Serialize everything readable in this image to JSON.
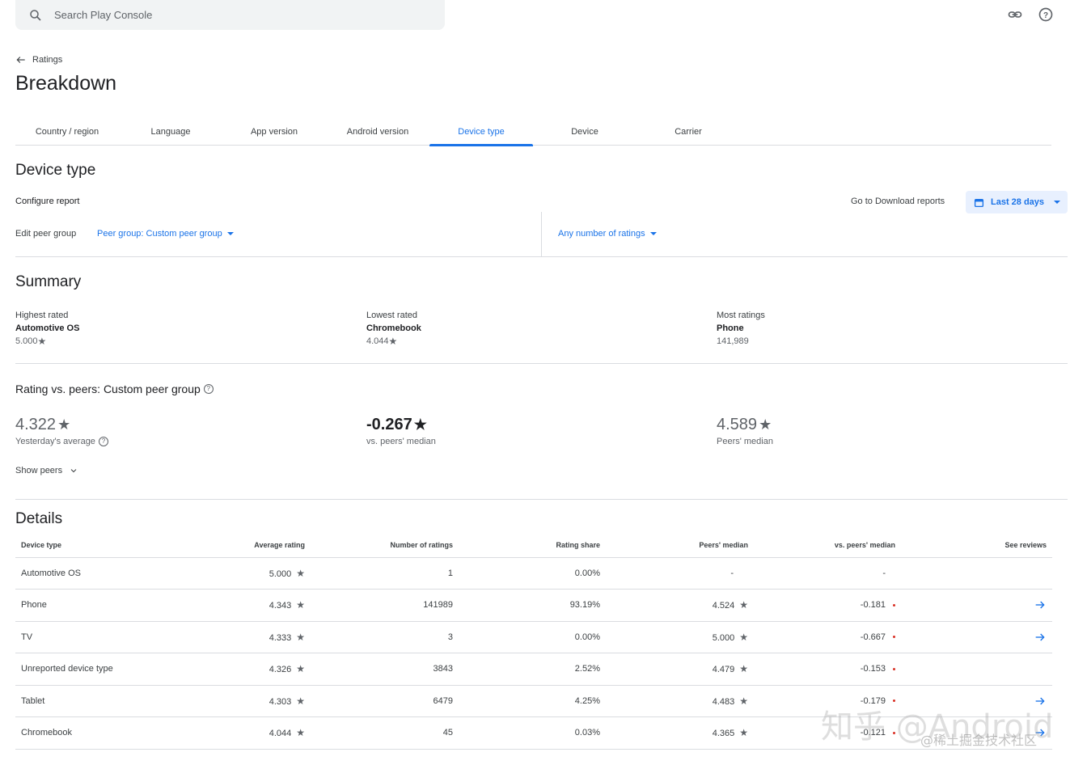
{
  "search": {
    "placeholder": "Search Play Console"
  },
  "header": {
    "back_label": "Ratings",
    "title": "Breakdown"
  },
  "tabs": [
    {
      "label": "Country / region"
    },
    {
      "label": "Language"
    },
    {
      "label": "App version"
    },
    {
      "label": "Android version"
    },
    {
      "label": "Device type"
    },
    {
      "label": "Device"
    },
    {
      "label": "Carrier"
    }
  ],
  "active_tab": "Device type",
  "section": {
    "title": "Device type",
    "configure_label": "Configure report",
    "download_link": "Go to Download reports",
    "date_range": "Last 28 days",
    "edit_peer_label": "Edit peer group",
    "peer_group_select": "Peer group: Custom peer group",
    "ratings_filter": "Any number of ratings"
  },
  "summary": {
    "title": "Summary",
    "highest": {
      "label": "Highest rated",
      "name": "Automotive OS",
      "value": "5.000"
    },
    "lowest": {
      "label": "Lowest rated",
      "name": "Chromebook",
      "value": "4.044"
    },
    "most": {
      "label": "Most ratings",
      "name": "Phone",
      "value": "141,989"
    }
  },
  "peers": {
    "title": "Rating vs. peers: Custom peer group",
    "average": {
      "value": "4.322",
      "label": "Yesterday's average"
    },
    "diff": {
      "value": "-0.267",
      "label": "vs. peers' median"
    },
    "median": {
      "value": "4.589",
      "label": "Peers' median"
    },
    "show_peers": "Show peers"
  },
  "details": {
    "title": "Details",
    "columns": [
      "Device type",
      "Average rating",
      "Number of ratings",
      "Rating share",
      "Peers' median",
      "vs. peers' median",
      "See reviews"
    ],
    "rows": [
      {
        "type": "Automotive OS",
        "avg": "5.000",
        "count": "1",
        "share": "0.00%",
        "peer": "-",
        "diff": "-",
        "has_peer_star": false,
        "has_dot": false,
        "reviews": false
      },
      {
        "type": "Phone",
        "avg": "4.343",
        "count": "141989",
        "share": "93.19%",
        "peer": "4.524",
        "diff": "-0.181",
        "has_peer_star": true,
        "has_dot": true,
        "reviews": true
      },
      {
        "type": "TV",
        "avg": "4.333",
        "count": "3",
        "share": "0.00%",
        "peer": "5.000",
        "diff": "-0.667",
        "has_peer_star": true,
        "has_dot": true,
        "reviews": true
      },
      {
        "type": "Unreported device type",
        "avg": "4.326",
        "count": "3843",
        "share": "2.52%",
        "peer": "4.479",
        "diff": "-0.153",
        "has_peer_star": true,
        "has_dot": true,
        "reviews": false
      },
      {
        "type": "Tablet",
        "avg": "4.303",
        "count": "6479",
        "share": "4.25%",
        "peer": "4.483",
        "diff": "-0.179",
        "has_peer_star": true,
        "has_dot": true,
        "reviews": true
      },
      {
        "type": "Chromebook",
        "avg": "4.044",
        "count": "45",
        "share": "0.03%",
        "peer": "4.365",
        "diff": "-0.121",
        "has_peer_star": true,
        "has_dot": true,
        "reviews": true
      }
    ]
  },
  "watermark": {
    "main": "知乎 @Android",
    "sub": "@稀土掘金技术社区"
  },
  "colors": {
    "accent": "#1a73e8",
    "negative_dot": "#d93025"
  }
}
